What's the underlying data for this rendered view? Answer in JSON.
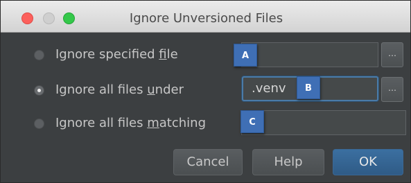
{
  "window": {
    "title": "Ignore Unversioned Files"
  },
  "options": [
    {
      "label_pre": "Ignore specified ",
      "label_key": "f",
      "label_post": "ile",
      "selected": false
    },
    {
      "label_pre": "Ignore all files ",
      "label_key": "u",
      "label_post": "nder",
      "selected": true
    },
    {
      "label_pre": "Ignore all files ",
      "label_key": "m",
      "label_post": "atching",
      "selected": false
    }
  ],
  "fields": {
    "specified_file": {
      "value": ""
    },
    "files_under": {
      "value": ".venv"
    },
    "files_matching": {
      "value": ""
    }
  },
  "browse_label": "…",
  "badges": [
    "A",
    "B",
    "C"
  ],
  "buttons": {
    "cancel": "Cancel",
    "help": "Help",
    "ok": "OK"
  },
  "colors": {
    "dialog_bg": "#3c3f41",
    "accent": "#3f6fb5",
    "ok_button": "#2f5b86"
  }
}
